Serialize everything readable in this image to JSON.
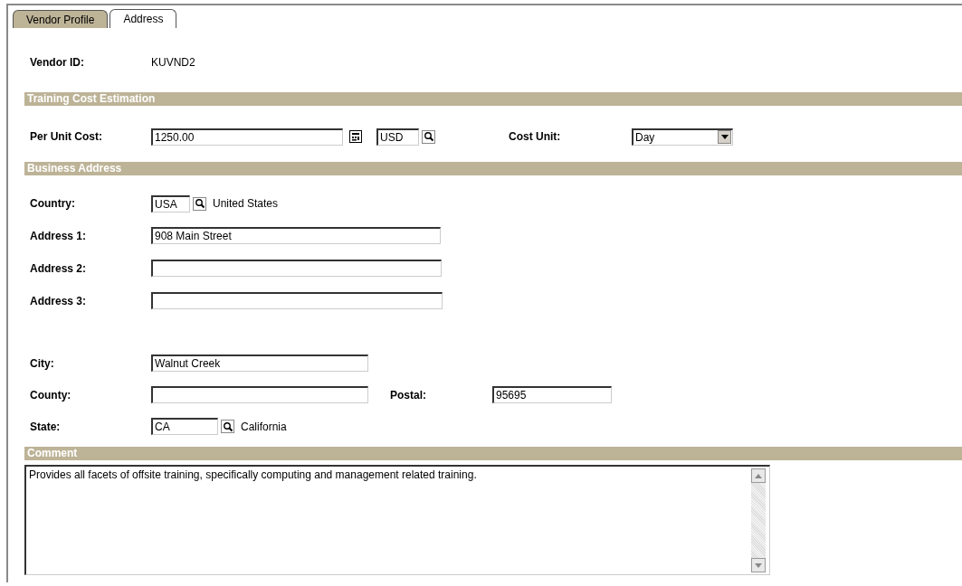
{
  "tabs": [
    {
      "label": "Vendor Profile",
      "selected": false
    },
    {
      "label": "Address",
      "selected": true
    }
  ],
  "vendor_id": {
    "label": "Vendor ID:",
    "value": "KUVND2"
  },
  "training_cost": {
    "title": "Training Cost Estimation",
    "per_unit_cost": {
      "label": "Per Unit Cost:",
      "value": "1250.00",
      "currency": "USD"
    },
    "cost_unit": {
      "label": "Cost Unit:",
      "value": "Day"
    }
  },
  "business_address": {
    "title": "Business Address",
    "country": {
      "label": "Country:",
      "code": "USA",
      "name": "United States"
    },
    "address_lines": [
      {
        "label": "Address 1:",
        "value": "908 Main Street"
      },
      {
        "label": "Address 2:"
      },
      {
        "label": "Address 3:"
      }
    ],
    "city": {
      "label": "City:",
      "value": "Walnut Creek"
    },
    "county": {
      "label": "County:"
    },
    "postal": {
      "label": "Postal:",
      "value": "95695"
    },
    "state": {
      "label": "State:",
      "code": "CA",
      "name": "California"
    }
  },
  "comment": {
    "title": "Comment",
    "value": "Provides all facets of offsite training, specifically computing and management related training."
  }
}
